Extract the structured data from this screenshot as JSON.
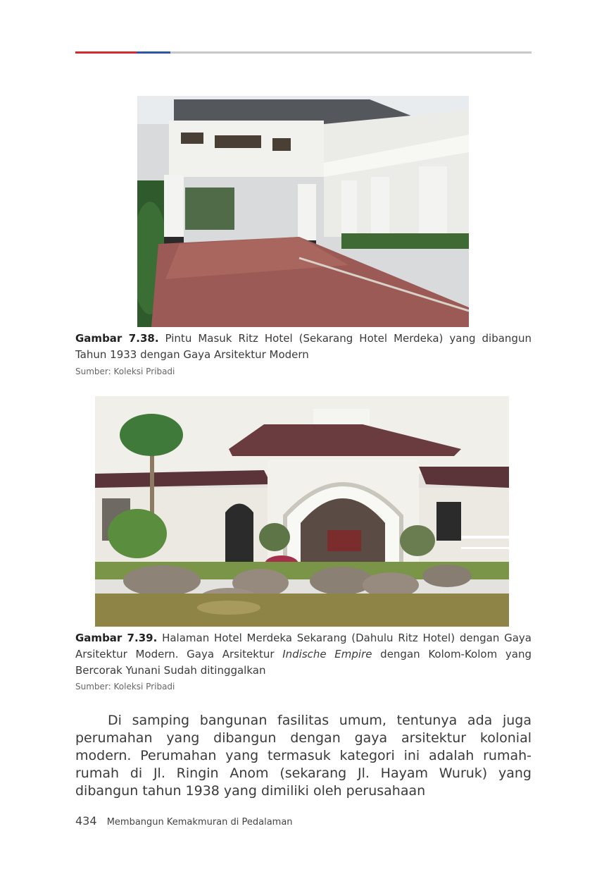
{
  "figure1": {
    "label": "Gambar 7.38.",
    "caption": "Pintu Masuk Ritz Hotel (Sekarang Hotel Merdeka) yang dibangun Tahun 1933 dengan Gaya Arsitektur Modern",
    "source": "Sumber: Koleksi Pribadi"
  },
  "figure2": {
    "label": "Gambar 7.39.",
    "caption_before": "Halaman Hotel Merdeka Sekarang (Dahulu Ritz Hotel) dengan Gaya Arsitektur Modern. Gaya Arsitektur",
    "caption_italic": "Indische Empire",
    "caption_after": "dengan Kolom-Kolom yang Bercorak Yunani Sudah ditinggalkan",
    "source": "Sumber: Koleksi Pribadi"
  },
  "body": {
    "paragraph": "Di samping bangunan fasilitas umum, tentunya ada juga perumahan yang dibangun dengan gaya arsitektur kolonial modern. Perumahan yang termasuk kategori ini adalah rumah-rumah di Jl. Ringin Anom (sekarang Jl. Hayam Wuruk) yang dibangun tahun 1938 yang dimiliki oleh perusahaan"
  },
  "footer": {
    "page_number": "434",
    "book_title": "Membangun Kemakmuran di Pedalaman"
  },
  "colors": {
    "rule_red": "#d42a2a",
    "rule_blue": "#2d55a5",
    "rule_gray": "#c8c8c8"
  }
}
